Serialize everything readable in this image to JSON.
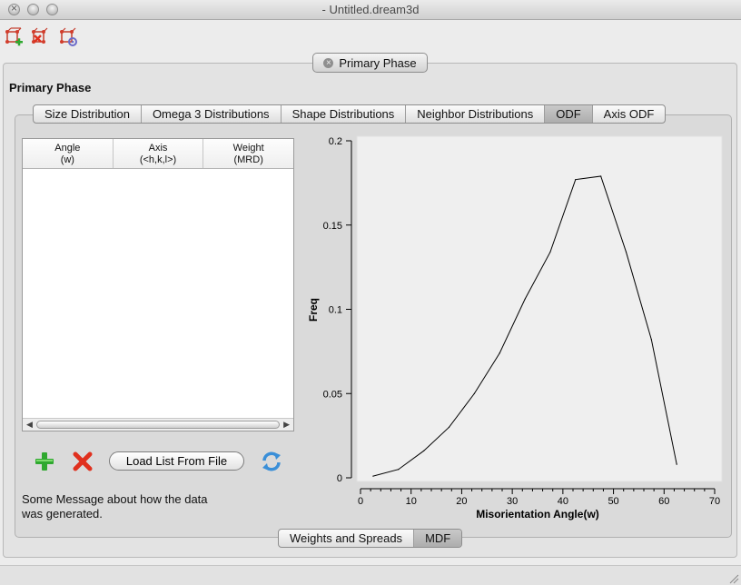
{
  "window": {
    "title": "- Untitled.dream3d"
  },
  "toolbar": {
    "icons": [
      "add-phase-icon",
      "remove-phase-icon",
      "edit-phase-icon"
    ]
  },
  "group": {
    "tab_label": "Primary Phase",
    "title": "Primary Phase"
  },
  "tabs": [
    {
      "label": "Size Distribution",
      "active": false
    },
    {
      "label": "Omega 3 Distributions",
      "active": false
    },
    {
      "label": "Shape Distributions",
      "active": false
    },
    {
      "label": "Neighbor Distributions",
      "active": false
    },
    {
      "label": "ODF",
      "active": true
    },
    {
      "label": "Axis ODF",
      "active": false
    }
  ],
  "table": {
    "columns": [
      {
        "line1": "Angle",
        "line2": "(w)"
      },
      {
        "line1": "Axis",
        "line2": "(<h,k,l>)"
      },
      {
        "line1": "Weight",
        "line2": "(MRD)"
      }
    ],
    "rows": []
  },
  "buttons": {
    "load_label": "Load List From File"
  },
  "message": {
    "line1": "Some Message about how the data",
    "line2": "was generated."
  },
  "bottom_tabs": [
    {
      "label": "Weights and Spreads",
      "active": false
    },
    {
      "label": "MDF",
      "active": true
    }
  ],
  "colors": {
    "plot_bg": "#efefef",
    "line": "#000000",
    "add_icon": "#2fa82f",
    "remove_icon": "#e0301e",
    "refresh_icon": "#3a8fd8"
  },
  "chart_data": {
    "type": "line",
    "xlabel": "Misorientation Angle(w)",
    "ylabel": "Freq",
    "xlim": [
      0,
      70
    ],
    "ylim": [
      0,
      0.2
    ],
    "xticks": [
      "0",
      "10",
      "20",
      "30",
      "40",
      "50",
      "60",
      "70"
    ],
    "yticks": [
      "0",
      "0.05",
      "0.1",
      "0.15",
      "0.2"
    ],
    "x": [
      2.5,
      7.5,
      12.5,
      17.5,
      22.5,
      27.5,
      32.5,
      37.5,
      42.5,
      47.5,
      52.5,
      57.5,
      62.5
    ],
    "y": [
      0.001,
      0.005,
      0.016,
      0.03,
      0.05,
      0.074,
      0.106,
      0.134,
      0.177,
      0.179,
      0.134,
      0.082,
      0.008
    ],
    "grid": false,
    "legend": "none"
  }
}
